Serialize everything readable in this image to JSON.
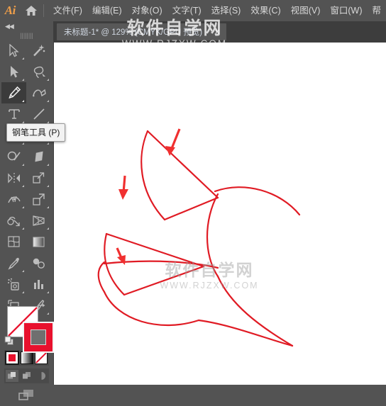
{
  "app": {
    "name": "Ai",
    "logo_color": "#f09f4a",
    "chrome_bg": "#535353",
    "accent_red": "#e8112d"
  },
  "menubar": {
    "home_icon": "home-icon",
    "items": [
      {
        "label": "文件(F)",
        "name": "menu-file"
      },
      {
        "label": "编辑(E)",
        "name": "menu-edit"
      },
      {
        "label": "对象(O)",
        "name": "menu-object"
      },
      {
        "label": "文字(T)",
        "name": "menu-type"
      },
      {
        "label": "选择(S)",
        "name": "menu-select"
      },
      {
        "label": "效果(C)",
        "name": "menu-effect"
      },
      {
        "label": "视图(V)",
        "name": "menu-view"
      },
      {
        "label": "窗口(W)",
        "name": "menu-window"
      },
      {
        "label": "帮",
        "name": "menu-help"
      }
    ]
  },
  "tabbar": {
    "document_title": "未标题-1* @ 129% (CMYK/GPU 预览)",
    "close_label": "×"
  },
  "toolbar": {
    "collapse_label": "◀◀",
    "grip_label": "||||||||",
    "tools": [
      {
        "name": "selection-tool",
        "icon": "selection-icon",
        "selected": false,
        "has_flyout": true
      },
      {
        "name": "magic-wand-tool",
        "icon": "magic-wand-icon",
        "selected": false,
        "has_flyout": false
      },
      {
        "name": "direct-selection-tool",
        "icon": "direct-selection-icon",
        "selected": false,
        "has_flyout": true
      },
      {
        "name": "lasso-tool",
        "icon": "lasso-icon",
        "selected": false,
        "has_flyout": true
      },
      {
        "name": "pen-tool",
        "icon": "pen-icon",
        "selected": true,
        "has_flyout": true
      },
      {
        "name": "curvature-tool",
        "icon": "curvature-icon",
        "selected": false,
        "has_flyout": true
      },
      {
        "name": "type-tool",
        "icon": "type-icon",
        "selected": false,
        "has_flyout": true
      },
      {
        "name": "line-segment-tool",
        "icon": "line-segment-icon",
        "selected": false,
        "has_flyout": true
      },
      {
        "name": "ellipse-tool",
        "icon": "ellipse-icon",
        "selected": false,
        "has_flyout": true
      },
      {
        "name": "paintbrush-tool",
        "icon": "paintbrush-icon",
        "selected": false,
        "has_flyout": true
      },
      {
        "name": "shaper-tool",
        "icon": "shaper-icon",
        "selected": false,
        "has_flyout": true
      },
      {
        "name": "eraser-tool",
        "icon": "eraser-icon",
        "selected": false,
        "has_flyout": true
      },
      {
        "name": "reflect-tool",
        "icon": "reflect-icon",
        "selected": false,
        "has_flyout": true
      },
      {
        "name": "scale-tool",
        "icon": "scale-icon",
        "selected": false,
        "has_flyout": true
      },
      {
        "name": "width-tool",
        "icon": "width-icon",
        "selected": false,
        "has_flyout": true
      },
      {
        "name": "free-transform-tool",
        "icon": "free-transform-icon",
        "selected": false,
        "has_flyout": true
      },
      {
        "name": "shape-builder-tool",
        "icon": "shape-builder-icon",
        "selected": false,
        "has_flyout": true
      },
      {
        "name": "perspective-grid-tool",
        "icon": "perspective-grid-icon",
        "selected": false,
        "has_flyout": true
      },
      {
        "name": "mesh-tool",
        "icon": "mesh-icon",
        "selected": false,
        "has_flyout": false
      },
      {
        "name": "gradient-tool",
        "icon": "gradient-icon",
        "selected": false,
        "has_flyout": false
      },
      {
        "name": "eyedropper-tool",
        "icon": "eyedropper-icon",
        "selected": false,
        "has_flyout": true
      },
      {
        "name": "blend-tool",
        "icon": "blend-icon",
        "selected": false,
        "has_flyout": false
      },
      {
        "name": "symbol-sprayer-tool",
        "icon": "symbol-sprayer-icon",
        "selected": false,
        "has_flyout": true
      },
      {
        "name": "column-graph-tool",
        "icon": "column-graph-icon",
        "selected": false,
        "has_flyout": true
      },
      {
        "name": "artboard-tool",
        "icon": "artboard-icon",
        "selected": false,
        "has_flyout": false
      },
      {
        "name": "slice-tool",
        "icon": "slice-icon",
        "selected": false,
        "has_flyout": true
      },
      {
        "name": "hand-tool",
        "icon": "hand-icon",
        "selected": false,
        "has_flyout": true
      },
      {
        "name": "zoom-tool",
        "icon": "zoom-icon",
        "selected": false,
        "has_flyout": false
      }
    ],
    "tooltip": "钢笔工具 (P)"
  },
  "color_controls": {
    "stroke_color": "#ffffff",
    "stroke_is_none": true,
    "fill_color": "#e8112d",
    "swap_icon": "swap-fill-stroke-icon",
    "default_icon": "default-fill-stroke-icon",
    "fill_modes": [
      {
        "name": "color-mode-button",
        "icon": "solid-color-icon",
        "active": true
      },
      {
        "name": "gradient-mode-button",
        "icon": "gradient-icon",
        "active": false
      },
      {
        "name": "none-mode-button",
        "icon": "none-swatch-icon",
        "active": false
      }
    ],
    "draw_modes": [
      {
        "name": "draw-normal-button",
        "icon": "draw-normal-icon",
        "active": true
      },
      {
        "name": "draw-behind-button",
        "icon": "draw-behind-icon",
        "active": false
      },
      {
        "name": "draw-inside-button",
        "icon": "draw-inside-icon",
        "active": false
      }
    ],
    "screen_mode": {
      "name": "change-screen-mode-button",
      "icon": "screen-mode-icon"
    }
  },
  "canvas": {
    "background": "#ffffff",
    "artwork": {
      "description": "红色花瓣线稿 (red petal outline sketch)",
      "stroke_color": "#e01b24",
      "stroke_width": 2,
      "annotation_arrow_color": "#f03030",
      "annotation_arrows": 3
    }
  },
  "watermark": {
    "cn": "软件自学网",
    "url": "WWW.RJZXW.COM"
  }
}
